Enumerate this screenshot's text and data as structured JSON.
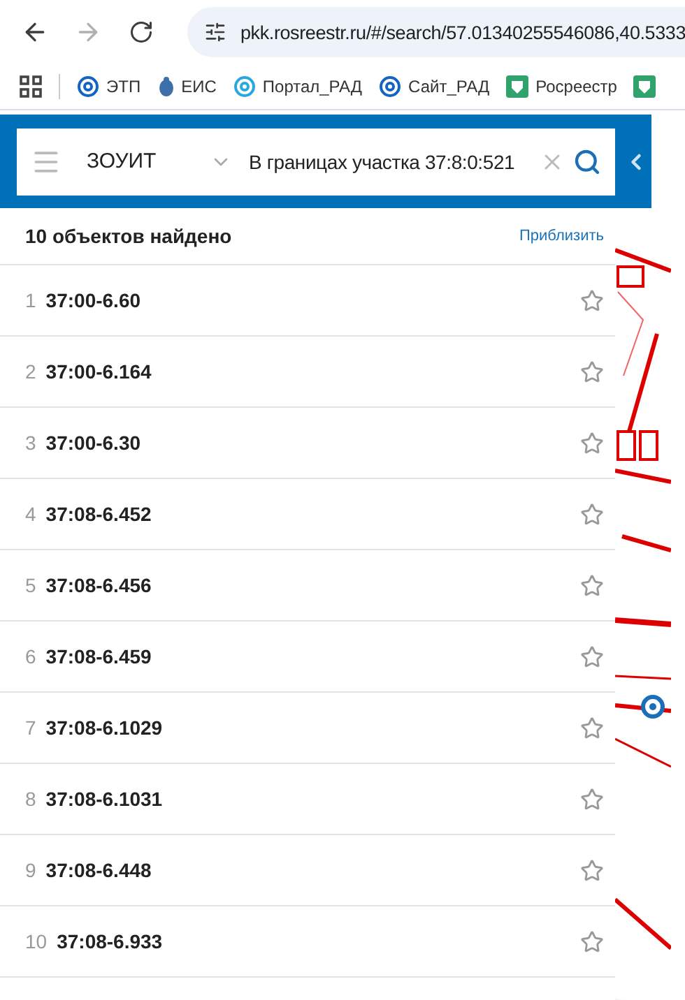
{
  "browser": {
    "nav": [
      {
        "kind": "back",
        "disabled": false
      },
      {
        "kind": "forward",
        "disabled": true
      },
      {
        "kind": "reload",
        "disabled": false
      }
    ],
    "url": "pkk.rosreestr.ru/#/search/57.01340255546086,40.5333",
    "bookmarks": [
      {
        "label": "ЭТП",
        "kind": "ring"
      },
      {
        "label": "ЕИС",
        "kind": "emblem"
      },
      {
        "label": "Портал_РАД",
        "kind": "ring-light"
      },
      {
        "label": "Сайт_РАД",
        "kind": "ring"
      },
      {
        "label": "Росреестр",
        "kind": "shield"
      },
      {
        "kind": "shield"
      }
    ]
  },
  "search": {
    "category": "ЗОУИТ",
    "query": "В границах участка 37:8:0:521"
  },
  "results": {
    "count": "10 объектов найдено",
    "zoom_link": "Приблизить",
    "items": [
      {
        "index": "1",
        "code": "37:00-6.60",
        "starred": false
      },
      {
        "index": "2",
        "code": "37:00-6.164",
        "starred": false
      },
      {
        "index": "3",
        "code": "37:00-6.30",
        "starred": false
      },
      {
        "index": "4",
        "code": "37:08-6.452",
        "starred": false
      },
      {
        "index": "5",
        "code": "37:08-6.456",
        "starred": false
      },
      {
        "index": "6",
        "code": "37:08-6.459",
        "starred": false
      },
      {
        "index": "7",
        "code": "37:08-6.1029",
        "starred": false
      },
      {
        "index": "8",
        "code": "37:08-6.1031",
        "starred": false
      },
      {
        "index": "9",
        "code": "37:08-6.448",
        "starred": false
      },
      {
        "index": "10",
        "code": "37:08-6.933",
        "starred": false
      }
    ]
  }
}
